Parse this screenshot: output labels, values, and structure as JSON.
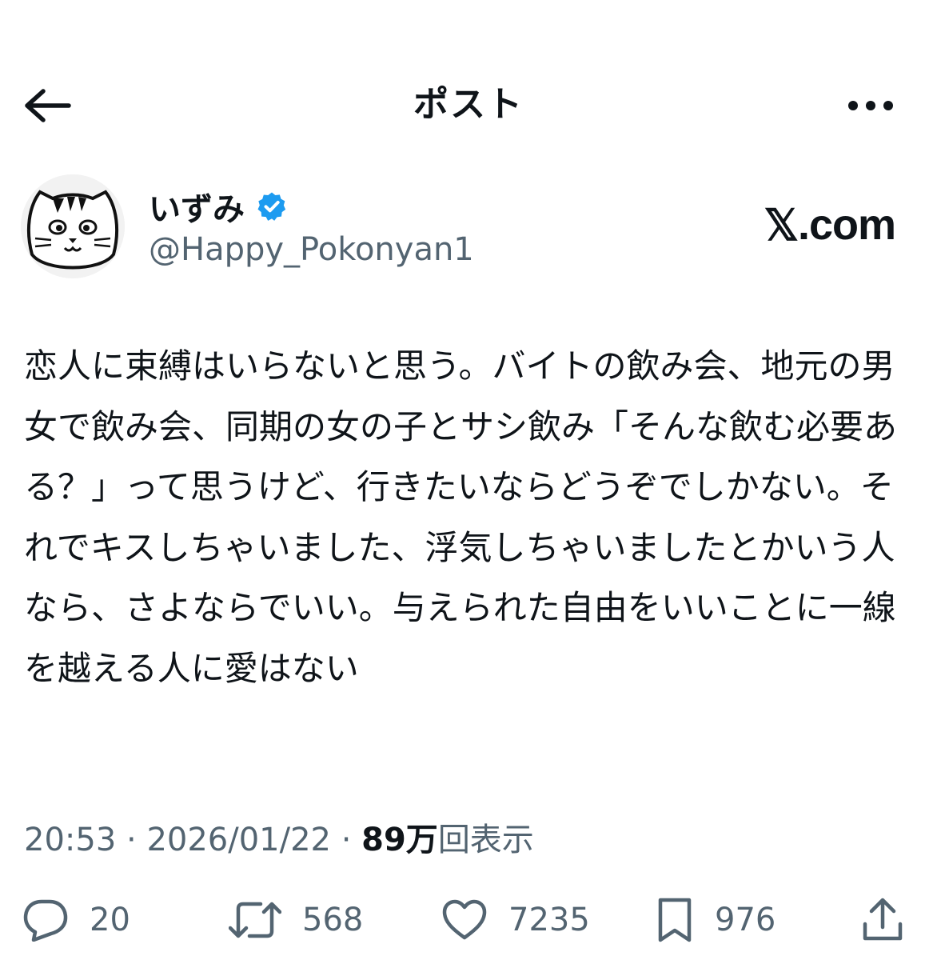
{
  "header": {
    "title": "ポスト"
  },
  "author": {
    "display_name": "いずみ",
    "handle": "@Happy_Pokonyan1",
    "verified": true
  },
  "watermark": {
    "logo_letter": "𝕏",
    "suffix": ".com"
  },
  "tweet": {
    "text": "恋人に束縛はいらないと思う。バイトの飲み会、地元の男女で飲み会、同期の女の子とサシ飲み「そんな飲む必要ある？」って思うけど、行きたいならどうぞでしかない。それでキスしちゃいました、浮気しちゃいましたとかいう人なら、さよならでいい。与えられた自由をいいことに一線を越える人に愛はない",
    "time": "20:53",
    "separator": "·",
    "date": "2026/01/22",
    "views_count": "89万",
    "views_label": "回表示"
  },
  "actions": {
    "replies": "20",
    "reposts": "568",
    "likes": "7235",
    "bookmarks": "976"
  },
  "icons": {
    "back": "arrow-left-icon",
    "more": "more-horizontal-icon",
    "verified": "verified-badge-icon",
    "reply": "reply-icon",
    "repost": "repost-icon",
    "like": "heart-icon",
    "bookmark": "bookmark-icon",
    "share": "share-icon"
  },
  "colors": {
    "text": "#0f1419",
    "secondary": "#536471",
    "verified": "#1d9bf0",
    "background": "#ffffff"
  }
}
